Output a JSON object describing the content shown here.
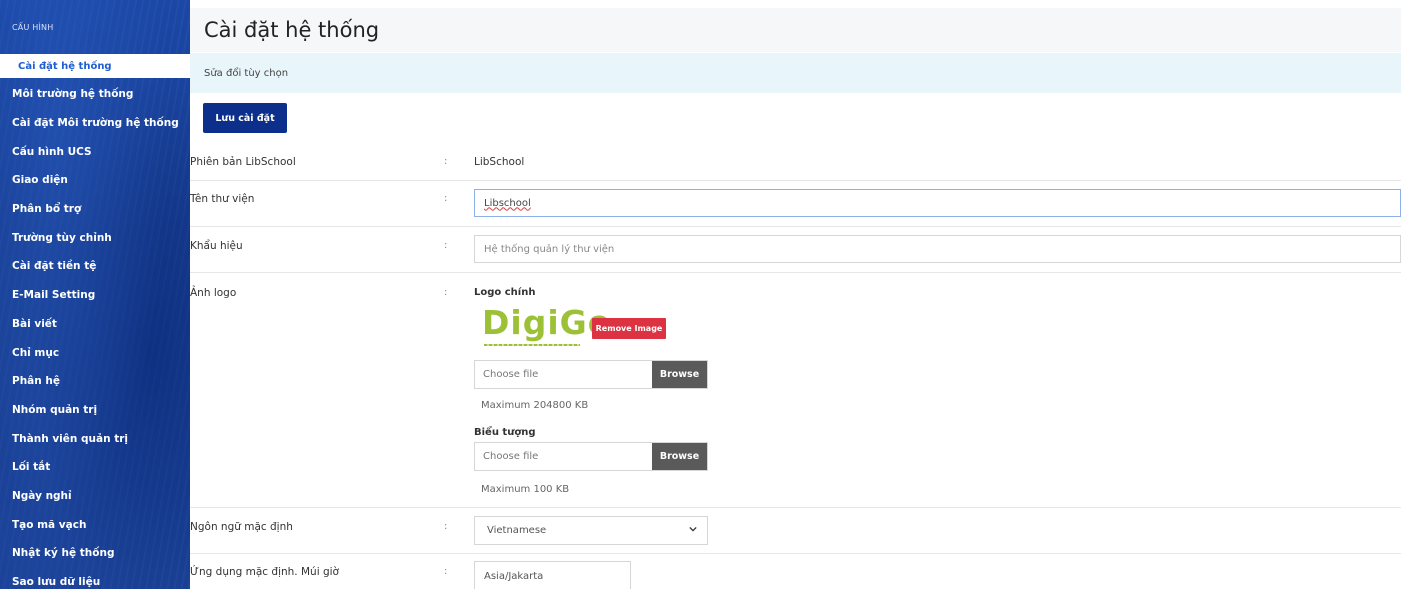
{
  "sidebar": {
    "header": "CẤU HÌNH",
    "items": [
      {
        "label": "Cài đặt hệ thống",
        "active": true
      },
      {
        "label": "Môi trường hệ thống"
      },
      {
        "label": "Cài đặt Môi trường hệ thống"
      },
      {
        "label": "Cấu hình UCS"
      },
      {
        "label": "Giao diện"
      },
      {
        "label": "Phân bổ trợ"
      },
      {
        "label": "Trường tùy chỉnh"
      },
      {
        "label": "Cài đặt tiền tệ"
      },
      {
        "label": "E-Mail Setting"
      },
      {
        "label": "Bài viết"
      },
      {
        "label": "Chỉ mục"
      },
      {
        "label": "Phân hệ"
      },
      {
        "label": "Nhóm quản trị"
      },
      {
        "label": "Thành viên quản trị"
      },
      {
        "label": "Lối tắt"
      },
      {
        "label": "Ngày nghỉ"
      },
      {
        "label": "Tạo mã vạch"
      },
      {
        "label": "Nhật ký hệ thống"
      },
      {
        "label": "Sao lưu dữ liệu"
      }
    ]
  },
  "main": {
    "title": "Cài đặt hệ thống",
    "subtitle": "Sửa đổi tùy chọn",
    "save_label": "Lưu cài đặt",
    "colon": ":",
    "fields": {
      "version": {
        "label": "Phiên bản LibSchool",
        "value": "LibSchool"
      },
      "library_name": {
        "label": "Tên thư viện",
        "value": "Libschool"
      },
      "slogan": {
        "label": "Khẩu hiệu",
        "placeholder": "Hệ thống quản lý thư viện"
      },
      "logo": {
        "label": "Ảnh logo",
        "main_logo_label": "Logo chính",
        "logo_text": "DigiGo",
        "remove_label": "Remove Image",
        "file_placeholder": "Choose file",
        "browse_label": "Browse",
        "main_max": "Maximum 204800 KB",
        "icon_label": "Biểu tượng",
        "icon_file_placeholder": "Choose file",
        "icon_browse_label": "Browse",
        "icon_max": "Maximum 100 KB"
      },
      "language": {
        "label": "Ngôn ngữ mặc định",
        "value": "Vietnamese"
      },
      "timezone": {
        "label": "Ứng dụng mặc định. Múi giờ",
        "value": "Asia/Jakarta"
      }
    }
  }
}
